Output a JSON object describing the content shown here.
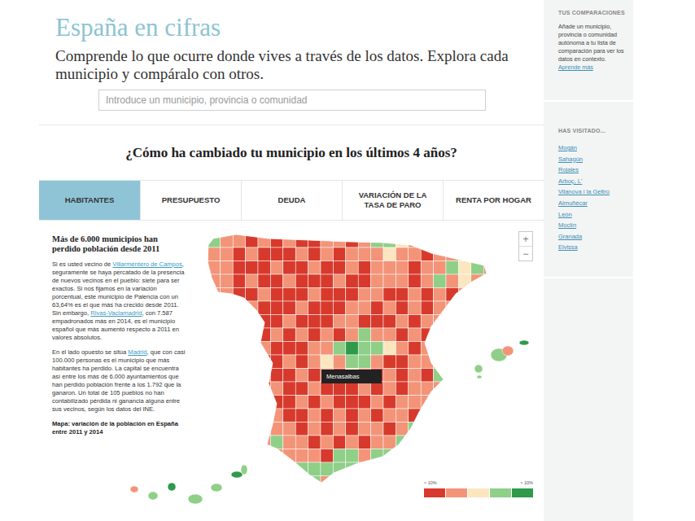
{
  "header": {
    "title": "España en cifras",
    "subtitle": "Comprende lo que ocurre donde vives a través de los datos. Explora cada municipio y compáralo con otros."
  },
  "search": {
    "placeholder": "Introduce un municipio, provincia o comunidad"
  },
  "section_title": "¿Cómo ha cambiado tu municipio en los últimos 4 años?",
  "tabs": [
    {
      "label": "HABITANTES",
      "selected": true
    },
    {
      "label": "PRESUPUESTO",
      "selected": false
    },
    {
      "label": "DEUDA",
      "selected": false
    },
    {
      "label": "VARIACIÓN DE LA TASA DE PARO",
      "selected": false
    },
    {
      "label": "RENTA POR HOGAR",
      "selected": false
    }
  ],
  "article": {
    "heading": "Más de 6.000 municipios han perdido población desde 2011",
    "paragraphs": [
      {
        "segments": [
          {
            "text": "Si es usted vecino de ",
            "link": false
          },
          {
            "text": "Villarmentero de Campos",
            "link": true
          },
          {
            "text": ", seguramente se haya percatado de la presencia de nuevos vecinos en el pueblo: siete para ser exactos. Si nos fijamos en la variación porcentual, este municipio de Palencia con un 63,64% es el que más ha crecido desde 2011. Sin embargo, ",
            "link": false
          },
          {
            "text": "Rivas-Vaciamadrid",
            "link": true
          },
          {
            "text": ", con 7.587 empadronados más en 2014, es el municipio español que más aumentó respecto a 2011 en valores absolutos.",
            "link": false
          }
        ]
      },
      {
        "segments": [
          {
            "text": "En el lado opuesto se sitúa ",
            "link": false
          },
          {
            "text": "Madrid",
            "link": true
          },
          {
            "text": ", que con casi 100.000 personas es el municipio que más habitantes ha perdido. La capital se encuentra así entre los más de 6.000 ayuntamientos que han perdido población frente a los 1.792 que la ganaron. Un total de 105 pueblos no han contabilizado pérdida ni ganancia alguna entre sus vecinos, según los datos del INE.",
            "link": false
          }
        ]
      }
    ],
    "caption": "Mapa: variación de la población en España entre 2011 y 2014"
  },
  "map": {
    "zoom_in": "+",
    "zoom_out": "−",
    "tooltip": "Menasalbas",
    "legend": {
      "min_label": "< 10%",
      "max_label": "> 10%",
      "colors": [
        "#d73a2c",
        "#f39478",
        "#fbe6c0",
        "#8fcf87",
        "#2e9a4a"
      ]
    },
    "cells": [
      "333111101110111322211111",
      "331101010011013321101111",
      "311010001010111211011331",
      "311000100100101110113231",
      "111010010001001110131211",
      "111001000100011001010131",
      "111010001000110101011111",
      "111100010001100010110111",
      "111100101010131101010111",
      "111101000113433210101111",
      "111110010121331001133111",
      "111111001010210101031111",
      "111110100100010101113111",
      "111111001010001011131111",
      "111111100101010110311111",
      "111111110101011013311111",
      "111111311010101133111111",
      "111111111103313311111111",
      "111111113333311111111111",
      "111111113311111111111111"
    ],
    "islands": [
      3,
      1,
      4,
      3,
      3,
      1,
      3,
      4,
      3,
      3,
      4,
      3
    ]
  },
  "sidebar": {
    "comparisons": {
      "title": "TUS COMPARACIONES",
      "text": "Añade un municipio, provincia o comunidad autónoma a tu lista de comparación para ver los datos en contexto.",
      "link": "Aprende más"
    },
    "visited": {
      "title": "HAS VISITADO...",
      "items": [
        "Mogán",
        "Sahagún",
        "Rojales",
        "Arboç, L'",
        "Vilanova i la Geltrú",
        "Almuñécar",
        "León",
        "Moclín",
        "Granada",
        "Elvissa"
      ]
    }
  }
}
